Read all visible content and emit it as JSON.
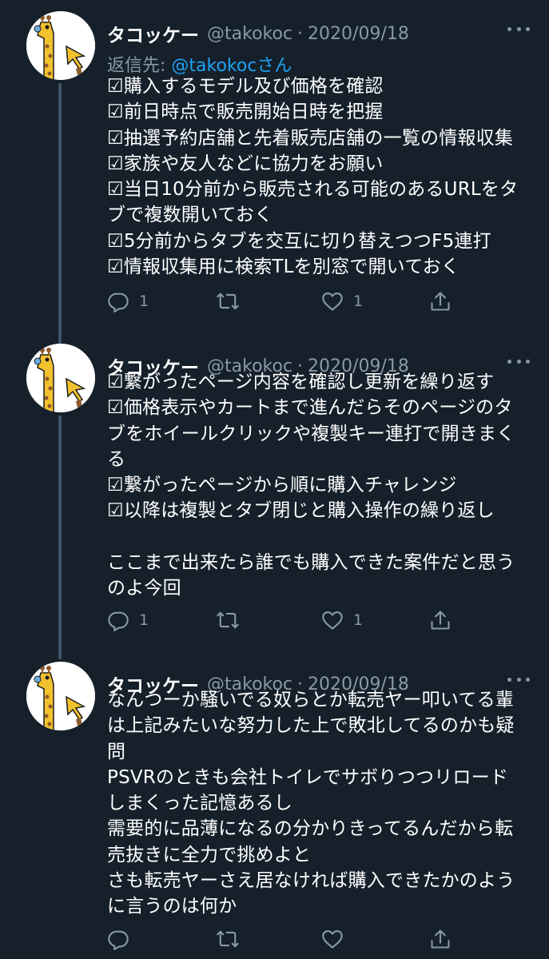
{
  "tweets": [
    {
      "author": {
        "name": "タコッケー",
        "handle": "@takokoc"
      },
      "dot": "·",
      "date": "2020/09/18",
      "reply_to": {
        "prefix": "返信先: ",
        "mention": "@takokoc",
        "suffix": "さん"
      },
      "lines": [
        "☑購入するモデル及び価格を確認",
        "☑前日時点で販売開始日時を把握",
        "☑抽選予約店舗と先着販売店舗の一覧の情報収集",
        "☑家族や友人などに協力をお願い",
        "☑当日10分前から販売される可能のあるURLをタ",
        "ブで複数開いておく",
        "☑5分前からタブを交互に切り替えつつF5連打",
        "☑情報収集用に検索TLを別窓で開いておく"
      ],
      "reply_count": "1",
      "retweet_count": "",
      "like_count": "1"
    },
    {
      "author": {
        "name": "タコッケー",
        "handle": "@takokoc"
      },
      "dot": "·",
      "date": "2020/09/18",
      "lines": [
        "☑繋がったページ内容を確認し更新を繰り返す",
        "☑価格表示やカートまで進んだらそのページのタ",
        "ブをホイールクリックや複製キー連打で開きまく",
        "る",
        "☑繋がったページから順に購入チャレンジ",
        "☑以降は複製とタブ閉じと購入操作の繰り返し",
        "",
        "ここまで出来たら誰でも購入できた案件だと思う",
        "のよ今回"
      ],
      "reply_count": "1",
      "retweet_count": "",
      "like_count": "1"
    },
    {
      "author": {
        "name": "タコッケー",
        "handle": "@takokoc"
      },
      "dot": "·",
      "date": "2020/09/18",
      "lines": [
        "なんつーか騒いでる奴らとか転売ヤー叩いてる輩",
        "は上記みたいな努力した上で敗北してるのかも疑",
        "問",
        "PSVRのときも会社トイレでサボりつつリロード",
        "しまくった記憶あるし",
        "需要的に品薄になるの分かりきってるんだから転",
        "売抜きに全力で挑めよと",
        "さも転売ヤーさえ居なければ購入できたかのよう",
        "に言うのは何か"
      ],
      "reply_count": "",
      "retweet_count": "",
      "like_count": ""
    }
  ],
  "icons": {
    "avatar": "giraffe-avatar-icon",
    "more": "more-options-icon",
    "reply": "reply-icon",
    "retweet": "retweet-icon",
    "like": "like-icon",
    "share": "share-icon"
  },
  "colors": {
    "background": "#15202b",
    "secondary_text": "#8899a6",
    "mention": "#1da1f2",
    "thread_line": "#3d5466"
  }
}
